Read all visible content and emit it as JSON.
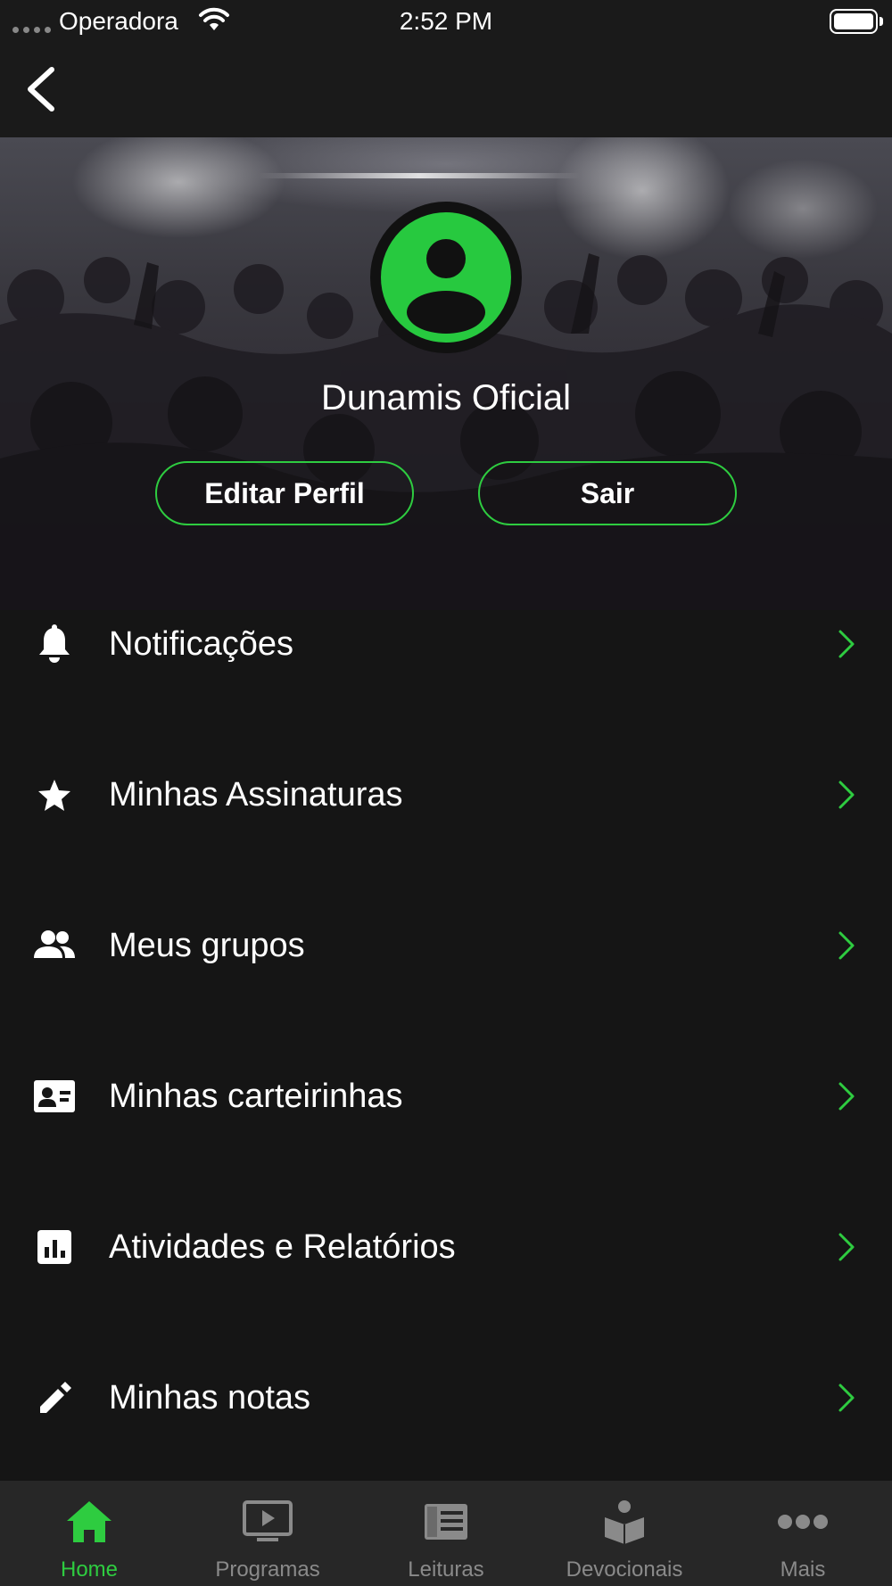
{
  "status_bar": {
    "carrier": "Operadora",
    "time": "2:52 PM"
  },
  "profile": {
    "name": "Dunamis Oficial",
    "edit_label": "Editar Perfil",
    "logout_label": "Sair"
  },
  "menu": {
    "items": [
      {
        "label": "Notificações",
        "icon": "bell-icon"
      },
      {
        "label": "Minhas Assinaturas",
        "icon": "star-icon"
      },
      {
        "label": "Meus grupos",
        "icon": "group-icon"
      },
      {
        "label": "Minhas carteirinhas",
        "icon": "id-card-icon"
      },
      {
        "label": "Atividades e Relatórios",
        "icon": "bar-chart-icon"
      },
      {
        "label": "Minhas notas",
        "icon": "pencil-icon"
      }
    ]
  },
  "tab_bar": {
    "tabs": [
      {
        "label": "Home",
        "icon": "home-icon",
        "active": true
      },
      {
        "label": "Programas",
        "icon": "tv-play-icon",
        "active": false
      },
      {
        "label": "Leituras",
        "icon": "newspaper-icon",
        "active": false
      },
      {
        "label": "Devocionais",
        "icon": "reading-person-icon",
        "active": false
      },
      {
        "label": "Mais",
        "icon": "more-dots-icon",
        "active": false
      }
    ]
  },
  "colors": {
    "accent": "#2ecc40",
    "background": "#151515",
    "tab_bar": "#272727",
    "inactive": "#8a8a8a"
  }
}
